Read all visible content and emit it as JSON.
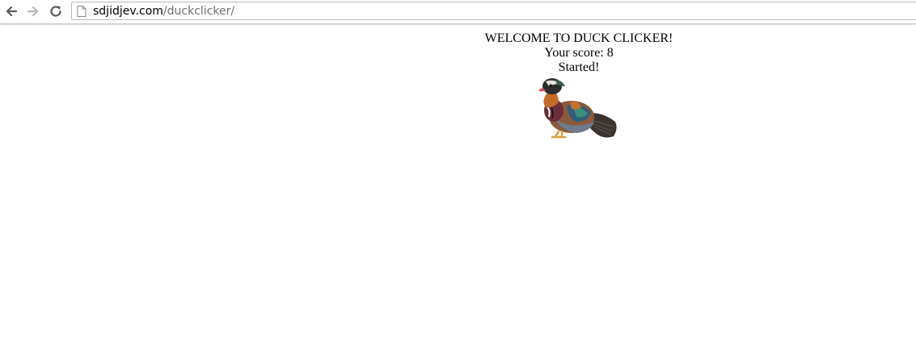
{
  "browser": {
    "url_host": "sdjidjev.com",
    "url_path": "/duckclicker/",
    "icons": {
      "back": "back-arrow-icon",
      "forward": "forward-arrow-icon",
      "reload": "reload-icon",
      "page": "page-icon"
    }
  },
  "game": {
    "heading": "WELCOME TO DUCK CLICKER!",
    "score_line": "Your score: 8",
    "status": "Started!",
    "duck_icon": "mandarin-duck-image"
  }
}
